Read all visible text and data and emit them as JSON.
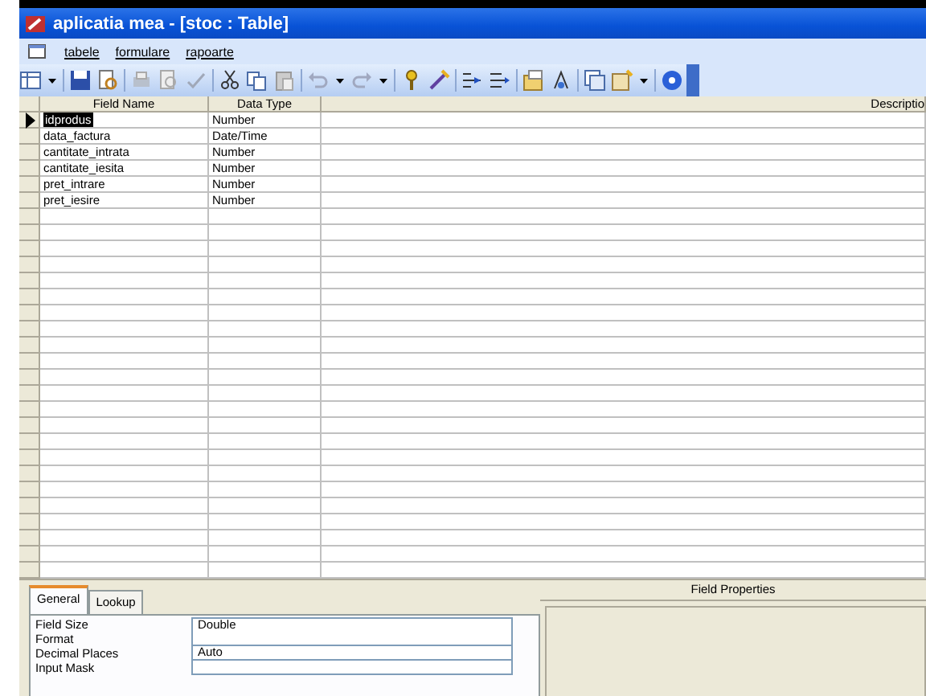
{
  "window": {
    "title": "aplicatia mea - [stoc : Table]"
  },
  "menu": [
    "tabele",
    "formulare",
    "rapoarte"
  ],
  "toolbar": [
    {
      "kind": "view"
    },
    {
      "kind": "caret"
    },
    {
      "kind": "sep"
    },
    {
      "kind": "save"
    },
    {
      "kind": "search-db"
    },
    {
      "kind": "sep"
    },
    {
      "kind": "print"
    },
    {
      "kind": "preview"
    },
    {
      "kind": "spell"
    },
    {
      "kind": "sep"
    },
    {
      "kind": "cut"
    },
    {
      "kind": "copy"
    },
    {
      "kind": "paste"
    },
    {
      "kind": "sep"
    },
    {
      "kind": "undo"
    },
    {
      "kind": "caret"
    },
    {
      "kind": "redo"
    },
    {
      "kind": "caret"
    },
    {
      "kind": "sep"
    },
    {
      "kind": "key"
    },
    {
      "kind": "builder"
    },
    {
      "kind": "sep"
    },
    {
      "kind": "insert-rows"
    },
    {
      "kind": "delete-rows"
    },
    {
      "kind": "sep"
    },
    {
      "kind": "properties"
    },
    {
      "kind": "indexes"
    },
    {
      "kind": "sep"
    },
    {
      "kind": "window"
    },
    {
      "kind": "new-object"
    },
    {
      "kind": "caret"
    },
    {
      "kind": "sep"
    },
    {
      "kind": "help"
    }
  ],
  "table": {
    "columns": [
      "Field Name",
      "Data Type",
      "Descriptio"
    ],
    "rows": [
      {
        "field_name": "idprodus",
        "data_type": "Number",
        "selected": true
      },
      {
        "field_name": "data_factura",
        "data_type": "Date/Time",
        "selected": false
      },
      {
        "field_name": "cantitate_intrata",
        "data_type": "Number",
        "selected": false
      },
      {
        "field_name": "cantitate_iesita",
        "data_type": "Number",
        "selected": false
      },
      {
        "field_name": "pret_intrare",
        "data_type": "Number",
        "selected": false
      },
      {
        "field_name": "pret_iesire",
        "data_type": "Number",
        "selected": false
      }
    ]
  },
  "field_properties": {
    "title": "Field Properties",
    "tabs": [
      {
        "label": "General",
        "selected": true
      },
      {
        "label": "Lookup",
        "selected": false
      }
    ],
    "properties": [
      {
        "label": "Field Size",
        "value": "Double"
      },
      {
        "label": "Format"
      },
      {
        "label": "Decimal Places",
        "value": "Auto"
      },
      {
        "label": "Input Mask"
      }
    ]
  }
}
